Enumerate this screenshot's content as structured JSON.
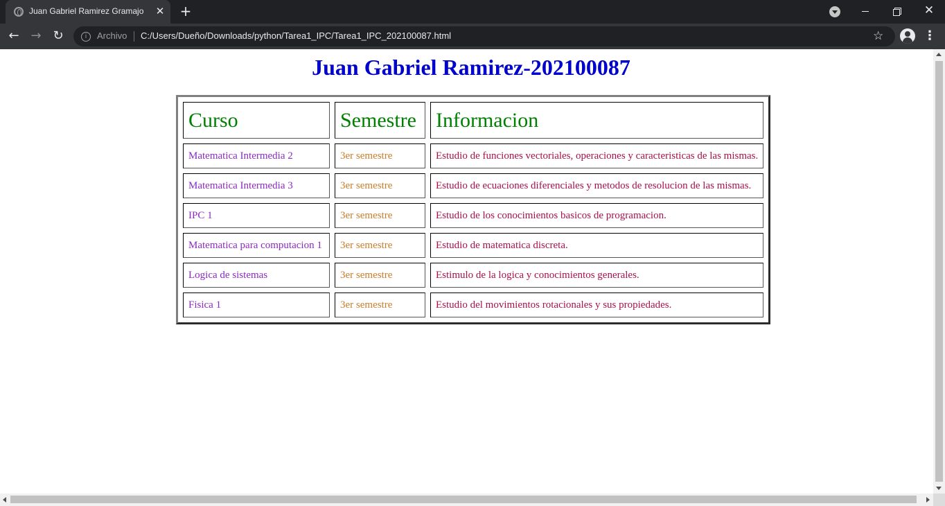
{
  "browser": {
    "tab_title": "Juan Gabriel Ramirez Gramajo",
    "tab_close": "✕",
    "new_tab": "+",
    "security_chip": "Archivo",
    "url": "C:/Users/Dueño/Downloads/python/Tarea1_IPC/Tarea1_IPC_202100087.html",
    "icons": [
      "globe-icon",
      "close-icon",
      "plus-icon",
      "tab-search-icon",
      "minimize-icon",
      "restore-icon",
      "window-close-icon",
      "back-icon",
      "forward-icon",
      "reload-icon",
      "info-icon",
      "star-icon",
      "profile-icon",
      "menu-icon"
    ]
  },
  "page": {
    "title": "Juan Gabriel Ramirez-202100087",
    "table": {
      "headers": [
        "Curso",
        "Semestre",
        "Informacion"
      ],
      "rows": [
        [
          "Matematica Intermedia 2",
          "3er semestre",
          "Estudio de funciones vectoriales, operaciones y caracteristicas de las mismas."
        ],
        [
          "Matematica Intermedia 3",
          "3er semestre",
          "Estudio de ecuaciones diferenciales y metodos de resolucion de las mismas."
        ],
        [
          "IPC 1",
          "3er semestre",
          "Estudio de los conocimientos basicos de programacion."
        ],
        [
          "Matematica para computacion 1",
          "3er semestre",
          "Estudio de matematica discreta."
        ],
        [
          "Logica de sistemas",
          "3er semestre",
          "Estimulo de la logica y conocimientos generales."
        ],
        [
          "Fisica 1",
          "3er semestre",
          "Estudio del movimientos rotacionales y sus propiedades."
        ]
      ]
    },
    "colors": {
      "title": "#0000cc",
      "header": "#008000",
      "curso": "#8a2ac0",
      "semestre": "#c87d2a",
      "informacion": "#a8104a"
    }
  }
}
